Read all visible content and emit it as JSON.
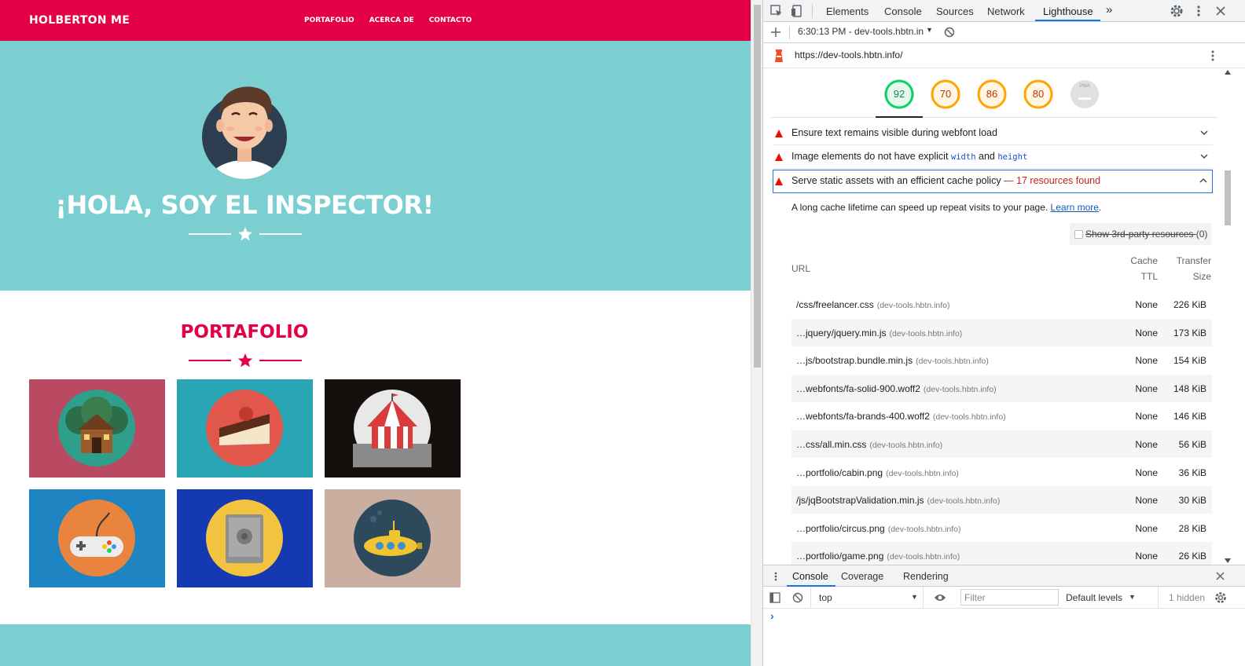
{
  "site": {
    "brand": "HOLBERTON ME",
    "nav": [
      "PORTAFOLIO",
      "ACERCA DE",
      "CONTACTO"
    ],
    "hero_title": "¡HOLA, SOY EL INSPECTOR!",
    "portfolio_title": "PORTAFOLIO",
    "tiles": [
      {
        "name": "cabin",
        "icon": "cabin-icon"
      },
      {
        "name": "cake",
        "icon": "cake-icon"
      },
      {
        "name": "circus",
        "icon": "circus-tent-icon"
      },
      {
        "name": "game",
        "icon": "gamepad-icon"
      },
      {
        "name": "safe",
        "icon": "safe-icon"
      },
      {
        "name": "submarine",
        "icon": "submarine-icon"
      }
    ],
    "colors": {
      "primary": "#e40046",
      "teal": "#7bcfd1"
    }
  },
  "devtools": {
    "tabs": [
      "Elements",
      "Console",
      "Sources",
      "Network",
      "Lighthouse"
    ],
    "active_tab": "Lighthouse",
    "more_tabs": "»",
    "report_label": "6:30:13 PM - dev-tools.hbtn.in",
    "url": "https://dev-tools.hbtn.info/",
    "scores": [
      {
        "value": "92",
        "color": "#0cce6b"
      },
      {
        "value": "70",
        "color": "#ffa400"
      },
      {
        "value": "86",
        "color": "#ffa400"
      },
      {
        "value": "80",
        "color": "#ffa400"
      },
      {
        "value": "PWA",
        "color": "#9aa0a6"
      }
    ],
    "audits": {
      "webfont": "Ensure text remains visible during webfont load",
      "img_prefix": "Image elements do not have explicit",
      "img_code1": "width",
      "img_and": "and",
      "img_code2": "height",
      "cache_title": "Serve static assets with an efficient cache policy",
      "cache_count": "— 17 resources found"
    },
    "description": "A long cache lifetime can speed up repeat visits to your page.",
    "learn_more": "Learn more",
    "period": ".",
    "third_party": "Show 3rd-party resources",
    "third_party_count": "(0)",
    "headers": {
      "url": "URL",
      "ttl_1": "Cache",
      "ttl_2": "TTL",
      "size_1": "Transfer",
      "size_2": "Size"
    },
    "rows": [
      {
        "url": "/css/freelancer.css",
        "host": "(dev-tools.hbtn.info)",
        "ttl": "None",
        "size": "226 KiB"
      },
      {
        "url": "…jquery/jquery.min.js",
        "host": "(dev-tools.hbtn.info)",
        "ttl": "None",
        "size": "173 KiB"
      },
      {
        "url": "…js/bootstrap.bundle.min.js",
        "host": "(dev-tools.hbtn.info)",
        "ttl": "None",
        "size": "154 KiB"
      },
      {
        "url": "…webfonts/fa-solid-900.woff2",
        "host": "(dev-tools.hbtn.info)",
        "ttl": "None",
        "size": "148 KiB"
      },
      {
        "url": "…webfonts/fa-brands-400.woff2",
        "host": "(dev-tools.hbtn.info)",
        "ttl": "None",
        "size": "146 KiB"
      },
      {
        "url": "…css/all.min.css",
        "host": "(dev-tools.hbtn.info)",
        "ttl": "None",
        "size": "56 KiB"
      },
      {
        "url": "…portfolio/cabin.png",
        "host": "(dev-tools.hbtn.info)",
        "ttl": "None",
        "size": "36 KiB"
      },
      {
        "url": "/js/jqBootstrapValidation.min.js",
        "host": "(dev-tools.hbtn.info)",
        "ttl": "None",
        "size": "30 KiB"
      },
      {
        "url": "…portfolio/circus.png",
        "host": "(dev-tools.hbtn.info)",
        "ttl": "None",
        "size": "28 KiB"
      },
      {
        "url": "…portfolio/game.png",
        "host": "(dev-tools.hbtn.info)",
        "ttl": "None",
        "size": "26 KiB"
      }
    ],
    "drawer_tabs": [
      "Console",
      "Coverage",
      "Rendering"
    ],
    "context": "top",
    "filter_placeholder": "Filter",
    "levels": "Default levels",
    "hidden": "1 hidden",
    "prompt": "›"
  }
}
